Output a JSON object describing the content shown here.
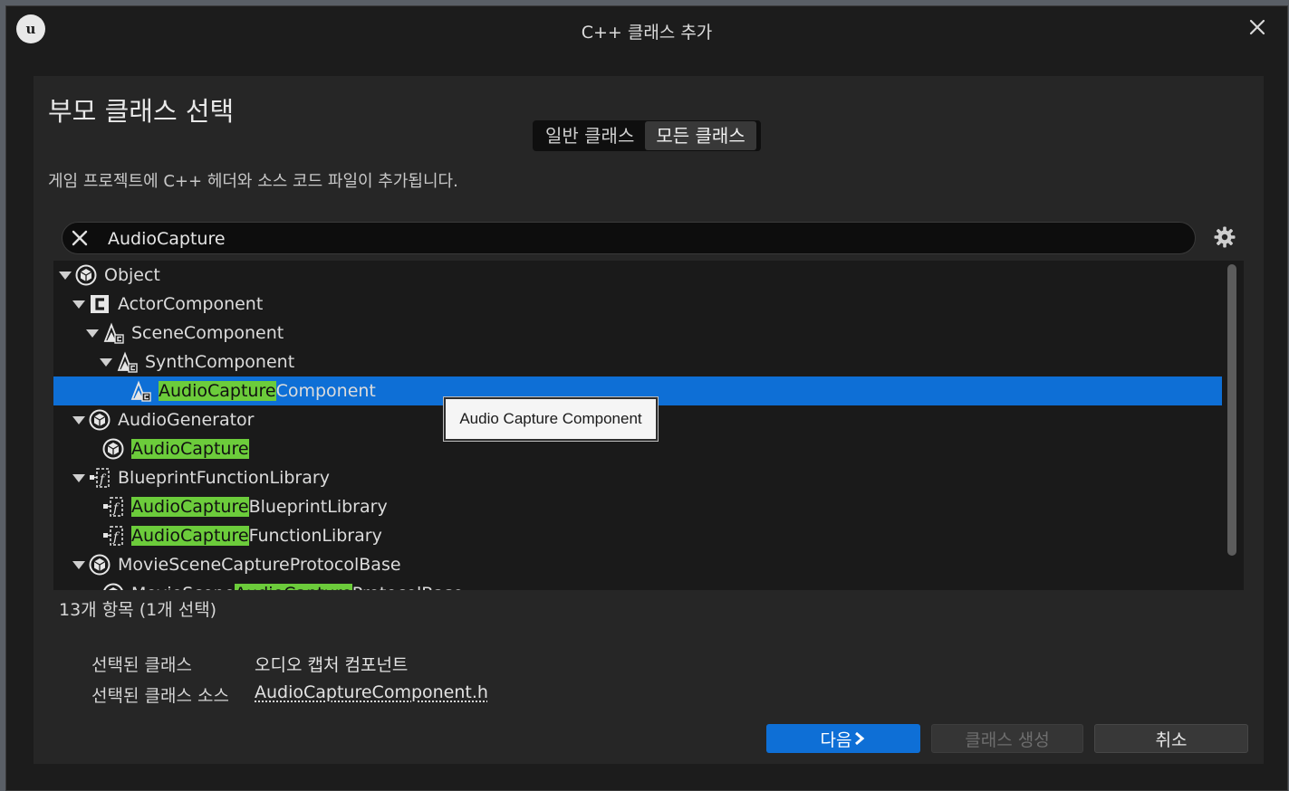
{
  "window": {
    "title": "C++ 클래스 추가"
  },
  "header": {
    "heading": "부모 클래스 선택",
    "tabs": [
      {
        "label": "일반 클래스",
        "active": false
      },
      {
        "label": "모든 클래스",
        "active": true
      }
    ],
    "description": "게임 프로젝트에 C++ 헤더와 소스 코드 파일이 추가됩니다."
  },
  "search": {
    "value": "AudioCapture",
    "placeholder": ""
  },
  "tree": {
    "highlight_color": "#6ccc3b",
    "selection_color": "#0e6fd6",
    "items": [
      {
        "indent": 0,
        "expanded": true,
        "icon": "cube-icon",
        "before": "Object",
        "match": "",
        "after": ""
      },
      {
        "indent": 1,
        "expanded": true,
        "icon": "class-c-icon",
        "before": "ActorComponent",
        "match": "",
        "after": ""
      },
      {
        "indent": 2,
        "expanded": true,
        "icon": "scene-component-icon",
        "before": "SceneComponent",
        "match": "",
        "after": ""
      },
      {
        "indent": 3,
        "expanded": true,
        "icon": "scene-component-icon",
        "before": "SynthComponent",
        "match": "",
        "after": ""
      },
      {
        "indent": 4,
        "expanded": null,
        "icon": "scene-component-icon",
        "before": "",
        "match": "AudioCapture",
        "after": "Component",
        "selected": true
      },
      {
        "indent": 1,
        "expanded": true,
        "icon": "cube-icon",
        "before": "AudioGenerator",
        "match": "",
        "after": ""
      },
      {
        "indent": 2,
        "expanded": null,
        "icon": "cube-icon",
        "before": "",
        "match": "AudioCapture",
        "after": ""
      },
      {
        "indent": 1,
        "expanded": true,
        "icon": "function-library-icon",
        "before": "BlueprintFunctionLibrary",
        "match": "",
        "after": ""
      },
      {
        "indent": 2,
        "expanded": null,
        "icon": "function-library-icon",
        "before": "",
        "match": "AudioCapture",
        "after": "BlueprintLibrary"
      },
      {
        "indent": 2,
        "expanded": null,
        "icon": "function-library-icon",
        "before": "",
        "match": "AudioCapture",
        "after": "FunctionLibrary"
      },
      {
        "indent": 1,
        "expanded": true,
        "icon": "cube-icon",
        "before": "MovieSceneCaptureProtocolBase",
        "match": "",
        "after": ""
      },
      {
        "indent": 2,
        "expanded": true,
        "icon": "cube-icon",
        "before": "MovieScene",
        "match": "AudioCapture",
        "after": "ProtocolBase"
      }
    ],
    "tooltip": "Audio Capture Component"
  },
  "status": {
    "count_text": "13개 항목 (1개 선택)"
  },
  "selection_info": {
    "class_label": "선택된 클래스",
    "class_value": "오디오 캡처 컴포넌트",
    "source_label": "선택된 클래스 소스",
    "source_value": "AudioCaptureComponent.h"
  },
  "buttons": {
    "next": "다음",
    "create": "클래스 생성",
    "cancel": "취소"
  }
}
